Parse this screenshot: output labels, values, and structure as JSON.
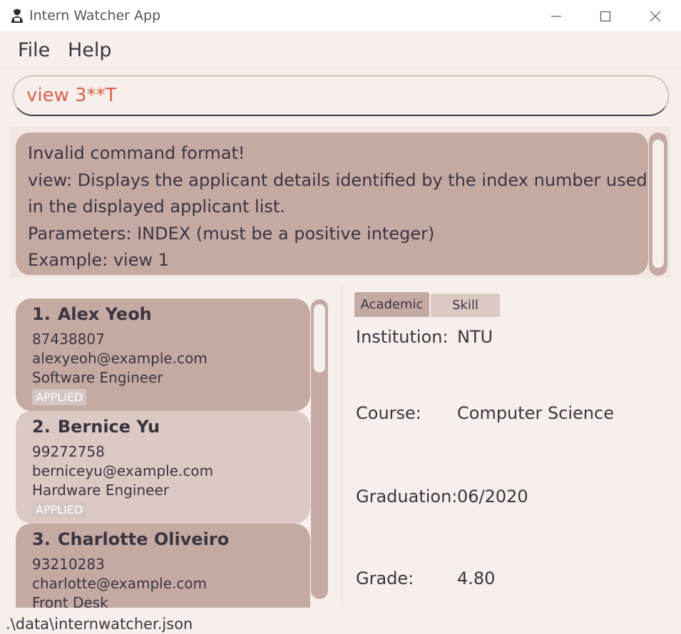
{
  "window": {
    "title": "Intern Watcher App",
    "icon": "app-logo-icon"
  },
  "menu": {
    "file": "File",
    "help": "Help"
  },
  "command": {
    "value": "view 3**T"
  },
  "result": {
    "lines": [
      "Invalid command format!",
      "view: Displays the applicant details identified by the index number used",
      "in the displayed applicant list.",
      "Parameters: INDEX (must be a positive integer)",
      "Example: view 1"
    ]
  },
  "applicants": [
    {
      "index": "1.",
      "name": "Alex Yeoh",
      "phone": "87438807",
      "email": "alexyeoh@example.com",
      "role": "Software Engineer",
      "status": "APPLIED"
    },
    {
      "index": "2.",
      "name": "Bernice Yu",
      "phone": "99272758",
      "email": "berniceyu@example.com",
      "role": "Hardware Engineer",
      "status": "APPLIED"
    },
    {
      "index": "3.",
      "name": "Charlotte Oliveiro",
      "phone": "93210283",
      "email": "charlotte@example.com",
      "role": "Front Desk",
      "status": ""
    }
  ],
  "detail": {
    "tabs": [
      "Academic",
      "Skill"
    ],
    "fields": [
      {
        "label": "Institution:",
        "value": "NTU"
      },
      {
        "label": "Course:",
        "value": "Computer Science"
      },
      {
        "label": "Graduation:",
        "value": "06/2020"
      },
      {
        "label": "Grade:",
        "value": "4.80"
      }
    ]
  },
  "status": {
    "path": ".\\data\\internwatcher.json"
  },
  "colors": {
    "background": "#f7efec",
    "card_selected": "#c5aaa4",
    "card_unselected": "#ddc9c4",
    "command_text": "#d9614e",
    "text": "#3b3540"
  }
}
